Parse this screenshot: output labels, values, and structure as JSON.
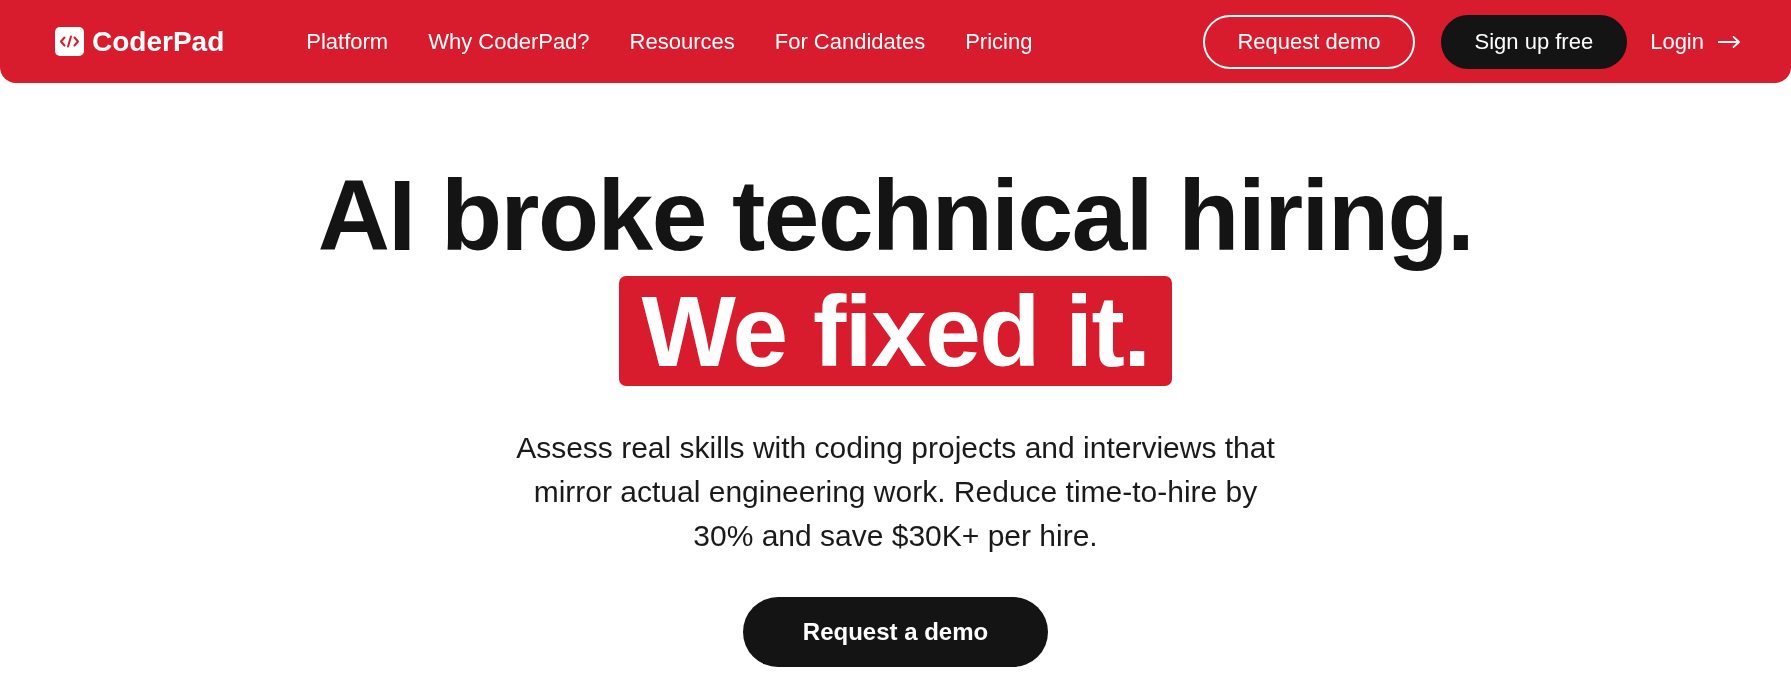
{
  "header": {
    "logo": "CoderPad",
    "nav_links": [
      "Platform",
      "Why CoderPad?",
      "Resources",
      "For Candidates",
      "Pricing"
    ],
    "buttons": [
      {
        "label": "Request demo",
        "kind": "outline"
      },
      {
        "label": "Sign up free",
        "kind": "solid"
      }
    ],
    "login_link": "Login"
  },
  "hero": {
    "title": "AI broke technical hiring.",
    "highlight": "We fixed it.",
    "description": "Assess real skills with coding projects and interviews that mirror actual engineering work. Reduce time-to-hire by 30% and save $30K+ per hire.",
    "cta": "Request a demo"
  }
}
